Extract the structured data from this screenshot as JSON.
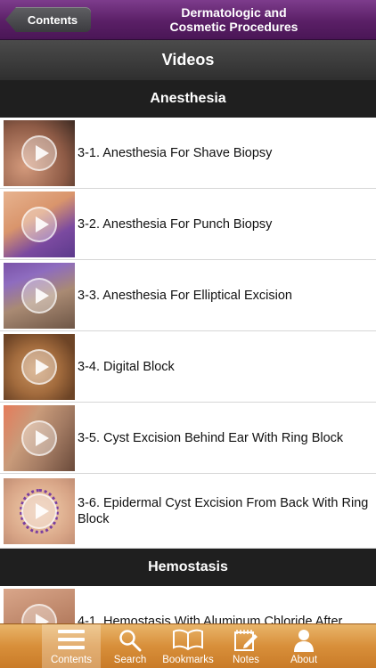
{
  "navbar": {
    "back_label": "Contents",
    "title_line1": "Dermatologic and",
    "title_line2": "Cosmetic Procedures"
  },
  "page": {
    "title": "Videos"
  },
  "sections": [
    {
      "title": "Anesthesia",
      "items": [
        "3-1. Anesthesia For Shave Biopsy",
        "3-2. Anesthesia For Punch Biopsy",
        "3-3. Anesthesia For Elliptical Excision",
        "3-4. Digital Block",
        "3-5. Cyst Excision Behind Ear With Ring Block",
        "3-6. Epidermal Cyst Excision From Back With Ring Block"
      ]
    },
    {
      "title": "Hemostasis",
      "items": [
        "4-1. Hemostasis With Aluminum Chloride After"
      ]
    }
  ],
  "tabbar": {
    "tabs": [
      {
        "label": "Contents",
        "icon": "list-icon",
        "active": true
      },
      {
        "label": "Search",
        "icon": "search-icon",
        "active": false
      },
      {
        "label": "Bookmarks",
        "icon": "book-icon",
        "active": false
      },
      {
        "label": "Notes",
        "icon": "notes-icon",
        "active": false
      },
      {
        "label": "About",
        "icon": "person-icon",
        "active": false
      }
    ]
  },
  "colors": {
    "navbar": "#5a1f66",
    "tabbar": "#d88f3a",
    "section_header": "#1f1f1f"
  }
}
